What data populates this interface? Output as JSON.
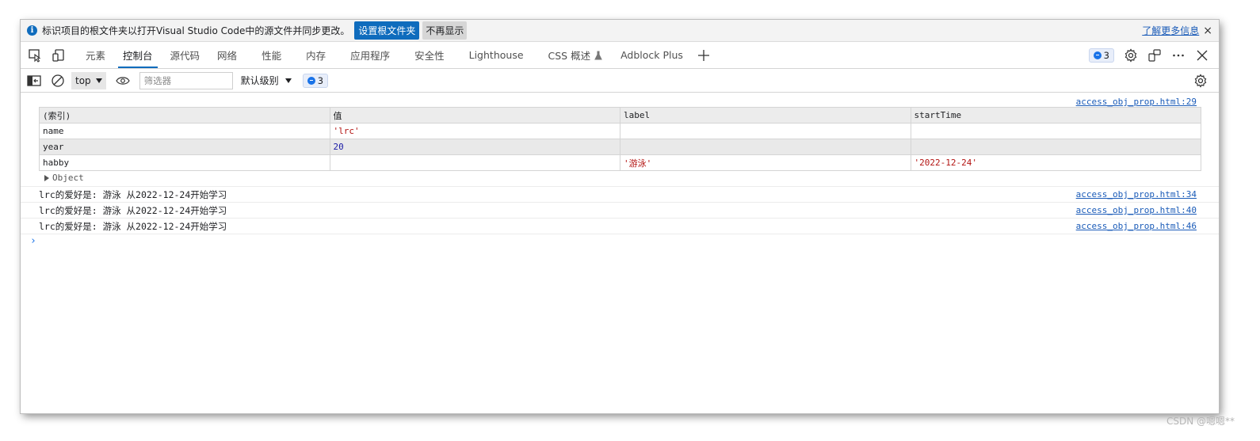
{
  "infobar": {
    "text": "标识项目的根文件夹以打开Visual Studio Code中的源文件并同步更改。",
    "primary_button": "设置根文件夹",
    "secondary_button": "不再显示",
    "learn_more": "了解更多信息",
    "close": "×"
  },
  "tabs": [
    {
      "label": "元素"
    },
    {
      "label": "控制台",
      "active": true
    },
    {
      "label": "源代码"
    },
    {
      "label": "网络"
    },
    {
      "label": "性能"
    },
    {
      "label": "内存"
    },
    {
      "label": "应用程序"
    },
    {
      "label": "安全性"
    },
    {
      "label": "Lighthouse"
    },
    {
      "label": "CSS 概述"
    },
    {
      "label": "Adblock Plus"
    }
  ],
  "tabbar": {
    "issues_count": "3"
  },
  "console_toolbar": {
    "context": "top",
    "filter_placeholder": "筛选器",
    "level": "默认级别",
    "issues_count": "3"
  },
  "table_message": {
    "source": "access_obj_prop.html:29",
    "headers": [
      "(索引)",
      "值",
      "label",
      "startTime"
    ],
    "rows": [
      {
        "index": "name",
        "value": "'lrc'",
        "label": "",
        "startTime": ""
      },
      {
        "index": "year",
        "value": "20",
        "label": "",
        "startTime": ""
      },
      {
        "index": "habby",
        "value": "",
        "label": "'游泳'",
        "startTime": "'2022-12-24'"
      }
    ],
    "object_label": "Object"
  },
  "logs": [
    {
      "text": "lrc的爱好是: 游泳 从2022-12-24开始学习",
      "source": "access_obj_prop.html:34"
    },
    {
      "text": "lrc的爱好是: 游泳 从2022-12-24开始学习",
      "source": "access_obj_prop.html:40"
    },
    {
      "text": "lrc的爱好是: 游泳 从2022-12-24开始学习",
      "source": "access_obj_prop.html:46"
    }
  ],
  "prompt": "›",
  "watermark": "CSDN @嗯嗯**",
  "colors": {
    "accent": "#0f6cbd",
    "string_value": "#b31412",
    "number_value": "#1a1aa6",
    "link": "#1a5bb8"
  }
}
